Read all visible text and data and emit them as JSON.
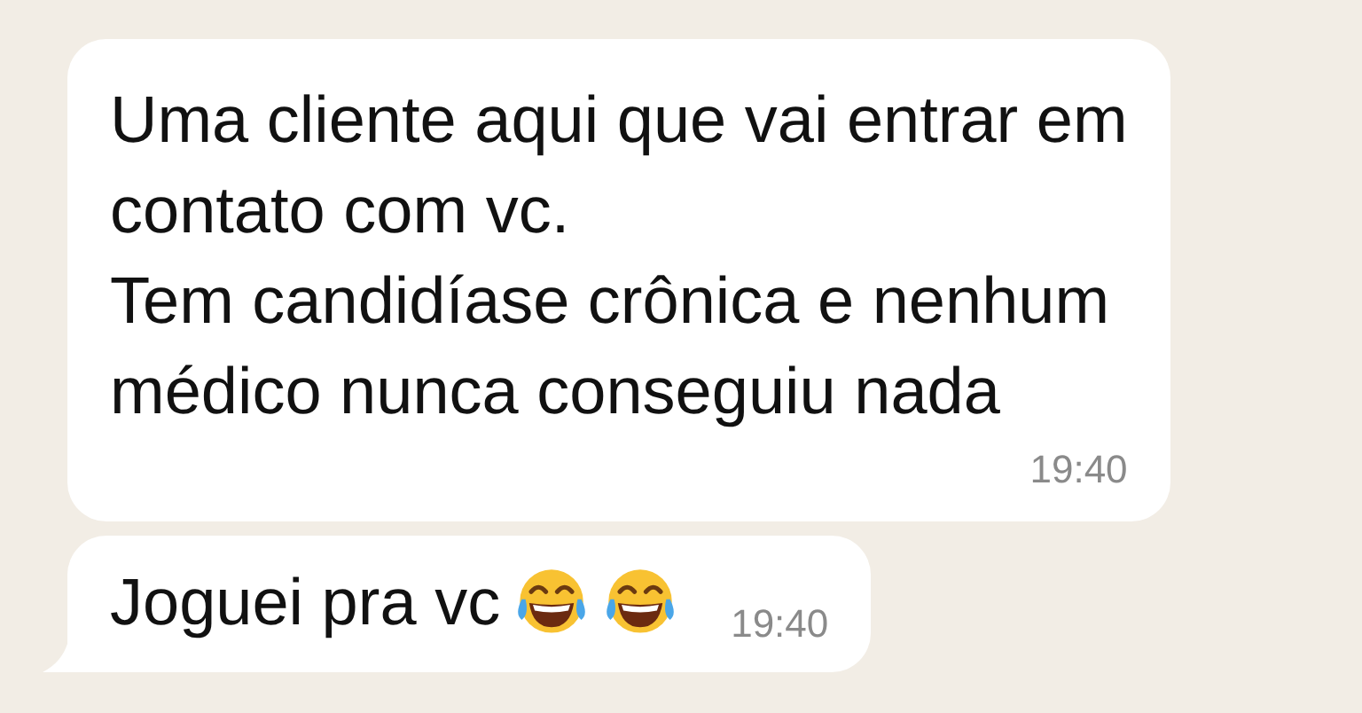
{
  "messages": [
    {
      "text": "Uma cliente aqui que vai entrar em\ncontato com vc.\nTem candidíase crônica e nenhum\nmédico nunca conseguiu nada",
      "time": "19:40",
      "tail": false
    },
    {
      "text": "Joguei pra vc",
      "time": "19:40",
      "tail": true,
      "emojis": [
        {
          "kind": "tears-of-joy"
        },
        {
          "kind": "tears-of-joy"
        }
      ]
    }
  ]
}
